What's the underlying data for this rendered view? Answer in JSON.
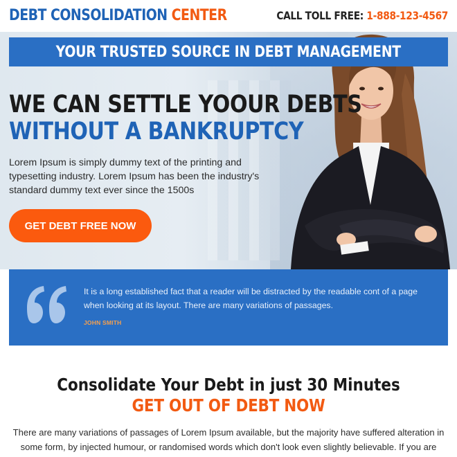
{
  "header": {
    "logo_part1": "DEBT CONSOLIDATION",
    "logo_part2": "CENTER",
    "toll_label": "CALL TOLL FREE:",
    "toll_number": "1-888-123-4567"
  },
  "hero": {
    "banner": "YOUR TRUSTED SOURCE IN DEBT MANAGEMENT",
    "headline_line1": "WE CAN SETTLE YOOUR DEBTS",
    "headline_line2": "WITHOUT A BANKRUPTCY",
    "paragraph": "Lorem Ipsum is simply dummy text of the printing and typesetting industry. Lorem Ipsum has been the industry's standard dummy text ever since the 1500s",
    "cta_label": "GET DEBT FREE NOW"
  },
  "testimonial": {
    "text": "It is a long established fact that a reader will be distracted by the readable cont of a page when looking at its layout. There are many variations of passages.",
    "author": "JOHN SMITH"
  },
  "section": {
    "title": "Consolidate Your Debt in just 30 Minutes",
    "subtitle": "GET OUT OF DEBT NOW",
    "paragraph": "There are many variations of passages of Lorem Ipsum available, but the majority have suffered alteration in some form, by injected humour, or randomised words which don't look even slightly believable. If you are going to use a passage of Lorem Ipsum, you need to be sure there isn't anything embarrassing"
  },
  "colors": {
    "brand_blue": "#1f63b6",
    "banner_blue": "#2a6fc4",
    "accent_orange": "#f25a12",
    "cta_orange": "#fb5a0e"
  },
  "icons": {
    "quote": "quote-icon",
    "person": "woman-portrait"
  }
}
